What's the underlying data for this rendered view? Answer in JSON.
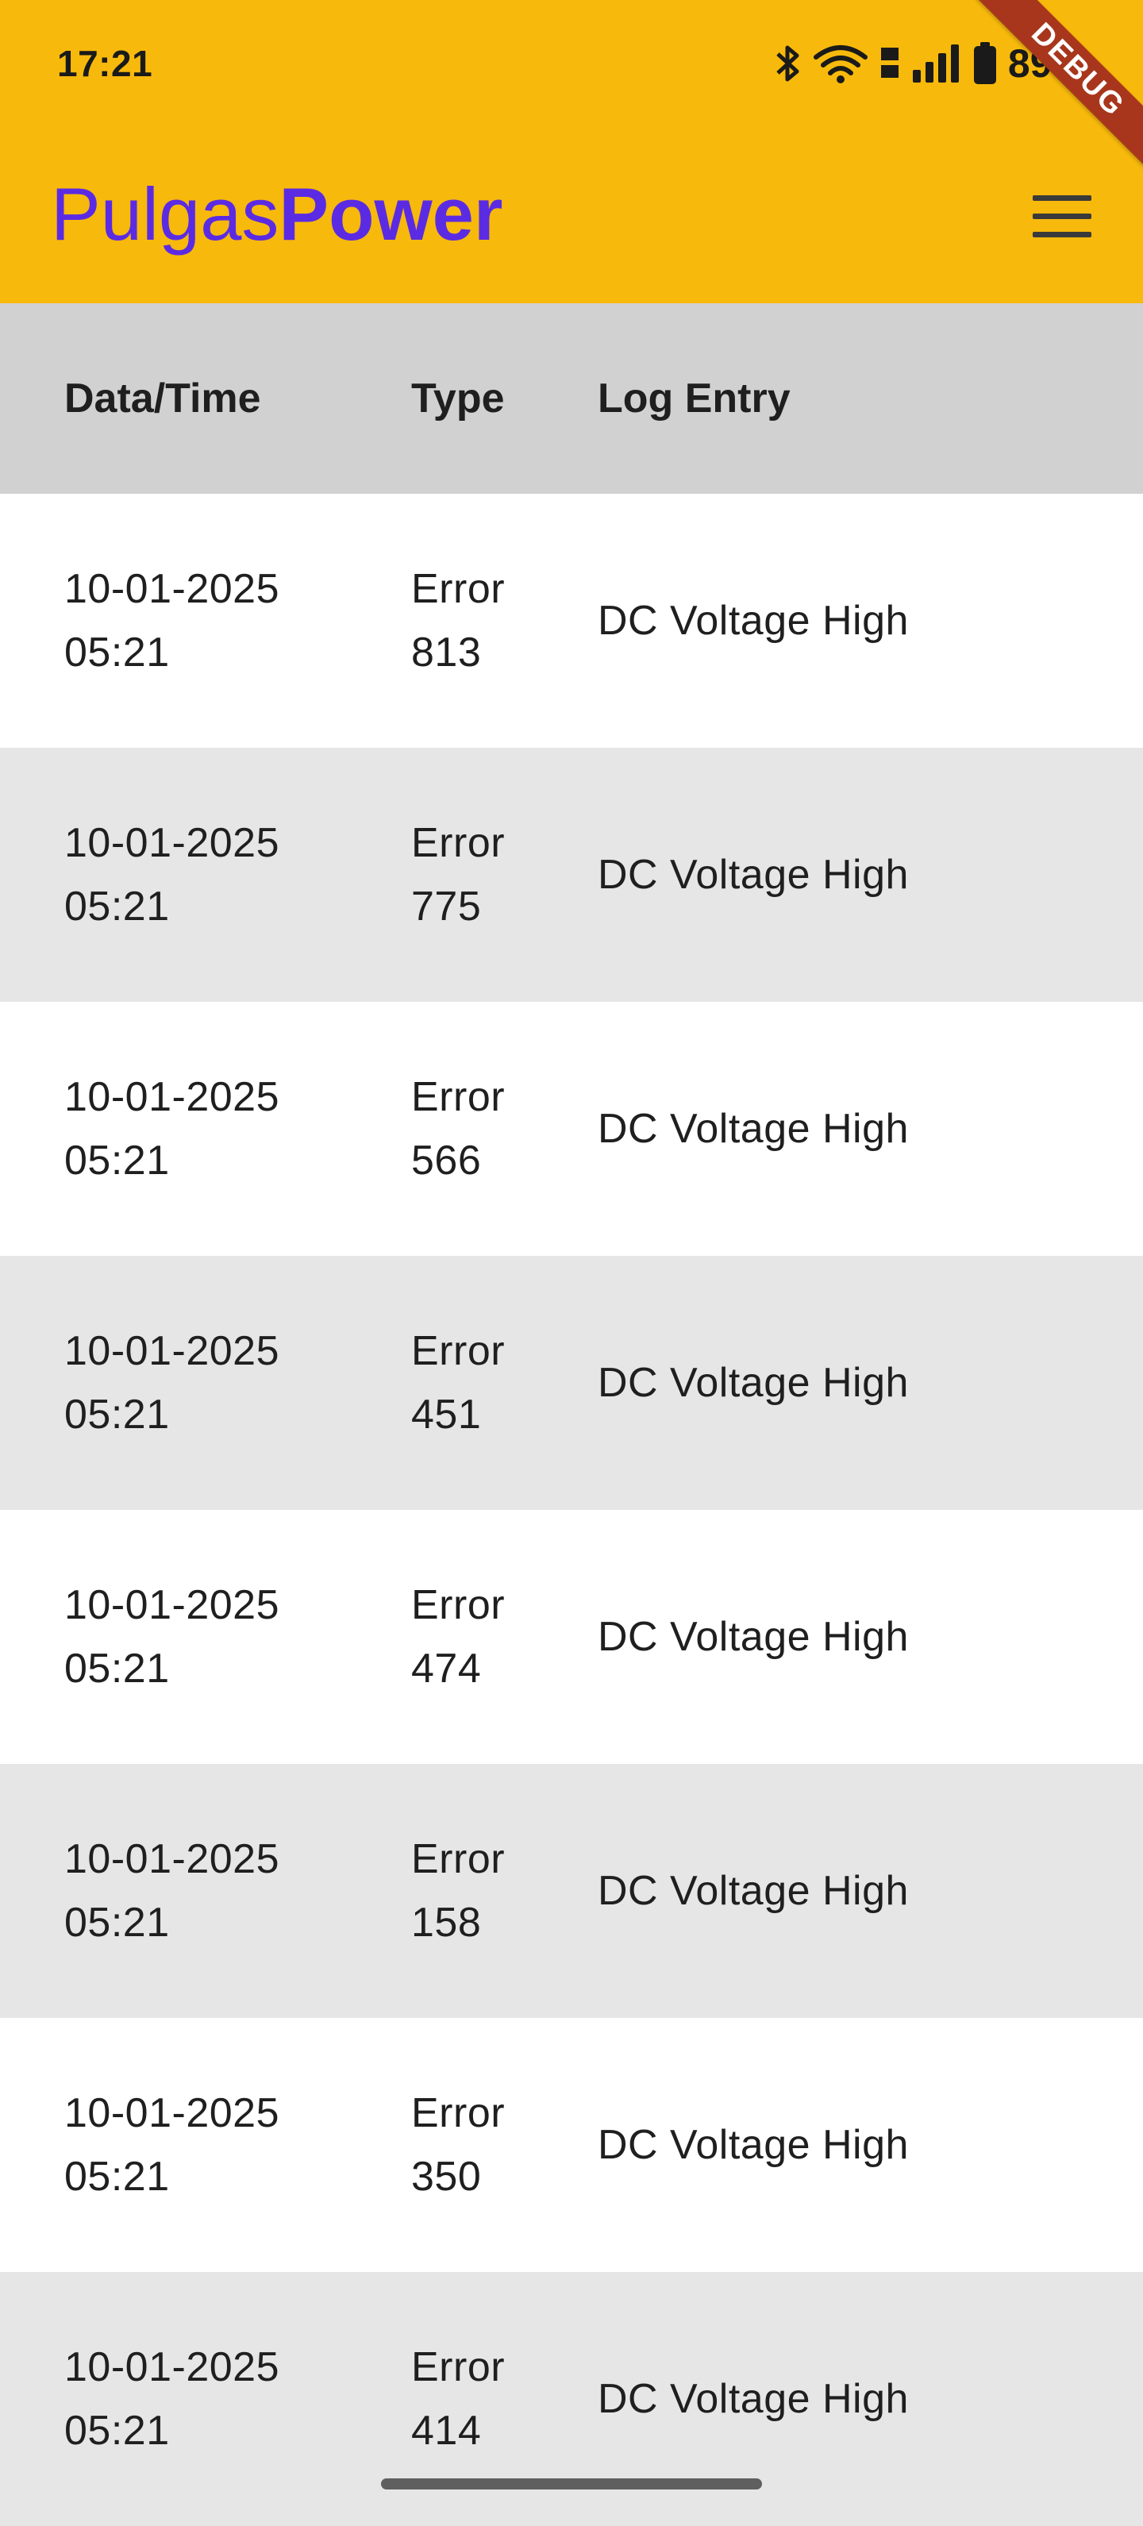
{
  "status_bar": {
    "time": "17:21",
    "battery": "89%",
    "icons": [
      "bluetooth-icon",
      "wifi-icon",
      "volte-icon",
      "signal-icon",
      "battery-icon"
    ]
  },
  "debug_banner": "DEBUG",
  "app_bar": {
    "title_regular": "Pulgas",
    "title_bold": "Power",
    "menu_icon": "hamburger-menu-icon"
  },
  "colors": {
    "app_bar": "#F7B90C",
    "title": "#5B2BE3",
    "header_row": "#D1D1D1",
    "alt_row": "#E6E6E6",
    "debug_ribbon": "#A8361C"
  },
  "table": {
    "headers": {
      "date": "Data/Time",
      "type": "Type",
      "log": "Log Entry"
    },
    "rows": [
      {
        "date": "10-01-2025",
        "time": "05:21",
        "type": "Error",
        "code": "813",
        "log": "DC Voltage High"
      },
      {
        "date": "10-01-2025",
        "time": "05:21",
        "type": "Error",
        "code": "775",
        "log": "DC Voltage High"
      },
      {
        "date": "10-01-2025",
        "time": "05:21",
        "type": "Error",
        "code": "566",
        "log": "DC Voltage High"
      },
      {
        "date": "10-01-2025",
        "time": "05:21",
        "type": "Error",
        "code": "451",
        "log": "DC Voltage High"
      },
      {
        "date": "10-01-2025",
        "time": "05:21",
        "type": "Error",
        "code": "474",
        "log": "DC Voltage High"
      },
      {
        "date": "10-01-2025",
        "time": "05:21",
        "type": "Error",
        "code": "158",
        "log": "DC Voltage High"
      },
      {
        "date": "10-01-2025",
        "time": "05:21",
        "type": "Error",
        "code": "350",
        "log": "DC Voltage High"
      },
      {
        "date": "10-01-2025",
        "time": "05:21",
        "type": "Error",
        "code": "414",
        "log": "DC Voltage High"
      }
    ]
  }
}
